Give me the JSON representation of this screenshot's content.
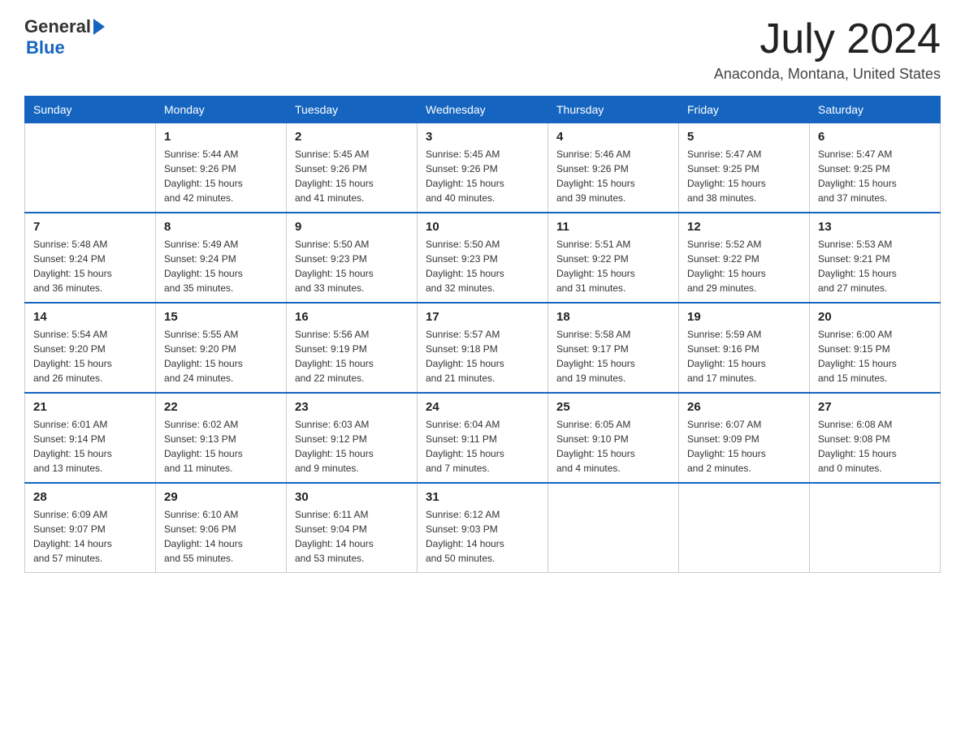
{
  "logo": {
    "general": "General",
    "blue": "Blue"
  },
  "header": {
    "month": "July 2024",
    "location": "Anaconda, Montana, United States"
  },
  "days_of_week": [
    "Sunday",
    "Monday",
    "Tuesday",
    "Wednesday",
    "Thursday",
    "Friday",
    "Saturday"
  ],
  "weeks": [
    [
      {
        "day": "",
        "info": ""
      },
      {
        "day": "1",
        "info": "Sunrise: 5:44 AM\nSunset: 9:26 PM\nDaylight: 15 hours\nand 42 minutes."
      },
      {
        "day": "2",
        "info": "Sunrise: 5:45 AM\nSunset: 9:26 PM\nDaylight: 15 hours\nand 41 minutes."
      },
      {
        "day": "3",
        "info": "Sunrise: 5:45 AM\nSunset: 9:26 PM\nDaylight: 15 hours\nand 40 minutes."
      },
      {
        "day": "4",
        "info": "Sunrise: 5:46 AM\nSunset: 9:26 PM\nDaylight: 15 hours\nand 39 minutes."
      },
      {
        "day": "5",
        "info": "Sunrise: 5:47 AM\nSunset: 9:25 PM\nDaylight: 15 hours\nand 38 minutes."
      },
      {
        "day": "6",
        "info": "Sunrise: 5:47 AM\nSunset: 9:25 PM\nDaylight: 15 hours\nand 37 minutes."
      }
    ],
    [
      {
        "day": "7",
        "info": "Sunrise: 5:48 AM\nSunset: 9:24 PM\nDaylight: 15 hours\nand 36 minutes."
      },
      {
        "day": "8",
        "info": "Sunrise: 5:49 AM\nSunset: 9:24 PM\nDaylight: 15 hours\nand 35 minutes."
      },
      {
        "day": "9",
        "info": "Sunrise: 5:50 AM\nSunset: 9:23 PM\nDaylight: 15 hours\nand 33 minutes."
      },
      {
        "day": "10",
        "info": "Sunrise: 5:50 AM\nSunset: 9:23 PM\nDaylight: 15 hours\nand 32 minutes."
      },
      {
        "day": "11",
        "info": "Sunrise: 5:51 AM\nSunset: 9:22 PM\nDaylight: 15 hours\nand 31 minutes."
      },
      {
        "day": "12",
        "info": "Sunrise: 5:52 AM\nSunset: 9:22 PM\nDaylight: 15 hours\nand 29 minutes."
      },
      {
        "day": "13",
        "info": "Sunrise: 5:53 AM\nSunset: 9:21 PM\nDaylight: 15 hours\nand 27 minutes."
      }
    ],
    [
      {
        "day": "14",
        "info": "Sunrise: 5:54 AM\nSunset: 9:20 PM\nDaylight: 15 hours\nand 26 minutes."
      },
      {
        "day": "15",
        "info": "Sunrise: 5:55 AM\nSunset: 9:20 PM\nDaylight: 15 hours\nand 24 minutes."
      },
      {
        "day": "16",
        "info": "Sunrise: 5:56 AM\nSunset: 9:19 PM\nDaylight: 15 hours\nand 22 minutes."
      },
      {
        "day": "17",
        "info": "Sunrise: 5:57 AM\nSunset: 9:18 PM\nDaylight: 15 hours\nand 21 minutes."
      },
      {
        "day": "18",
        "info": "Sunrise: 5:58 AM\nSunset: 9:17 PM\nDaylight: 15 hours\nand 19 minutes."
      },
      {
        "day": "19",
        "info": "Sunrise: 5:59 AM\nSunset: 9:16 PM\nDaylight: 15 hours\nand 17 minutes."
      },
      {
        "day": "20",
        "info": "Sunrise: 6:00 AM\nSunset: 9:15 PM\nDaylight: 15 hours\nand 15 minutes."
      }
    ],
    [
      {
        "day": "21",
        "info": "Sunrise: 6:01 AM\nSunset: 9:14 PM\nDaylight: 15 hours\nand 13 minutes."
      },
      {
        "day": "22",
        "info": "Sunrise: 6:02 AM\nSunset: 9:13 PM\nDaylight: 15 hours\nand 11 minutes."
      },
      {
        "day": "23",
        "info": "Sunrise: 6:03 AM\nSunset: 9:12 PM\nDaylight: 15 hours\nand 9 minutes."
      },
      {
        "day": "24",
        "info": "Sunrise: 6:04 AM\nSunset: 9:11 PM\nDaylight: 15 hours\nand 7 minutes."
      },
      {
        "day": "25",
        "info": "Sunrise: 6:05 AM\nSunset: 9:10 PM\nDaylight: 15 hours\nand 4 minutes."
      },
      {
        "day": "26",
        "info": "Sunrise: 6:07 AM\nSunset: 9:09 PM\nDaylight: 15 hours\nand 2 minutes."
      },
      {
        "day": "27",
        "info": "Sunrise: 6:08 AM\nSunset: 9:08 PM\nDaylight: 15 hours\nand 0 minutes."
      }
    ],
    [
      {
        "day": "28",
        "info": "Sunrise: 6:09 AM\nSunset: 9:07 PM\nDaylight: 14 hours\nand 57 minutes."
      },
      {
        "day": "29",
        "info": "Sunrise: 6:10 AM\nSunset: 9:06 PM\nDaylight: 14 hours\nand 55 minutes."
      },
      {
        "day": "30",
        "info": "Sunrise: 6:11 AM\nSunset: 9:04 PM\nDaylight: 14 hours\nand 53 minutes."
      },
      {
        "day": "31",
        "info": "Sunrise: 6:12 AM\nSunset: 9:03 PM\nDaylight: 14 hours\nand 50 minutes."
      },
      {
        "day": "",
        "info": ""
      },
      {
        "day": "",
        "info": ""
      },
      {
        "day": "",
        "info": ""
      }
    ]
  ]
}
